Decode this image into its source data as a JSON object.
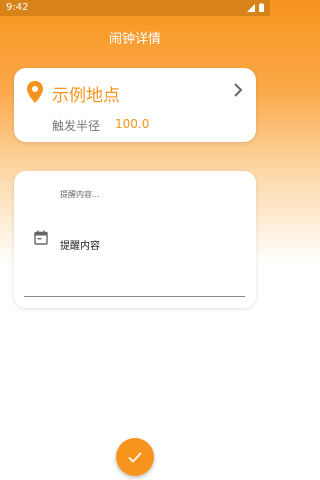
{
  "status_bar": {
    "time": "9:42",
    "icons": [
      "signal-icon",
      "battery-icon"
    ]
  },
  "header": {
    "title": "闹钟详情"
  },
  "location_card": {
    "icon": "location-pin-icon",
    "location_name": "示例地点",
    "radius_label": "触发半径",
    "radius_value": "100.0",
    "nav_icon": "chevron-right-icon"
  },
  "content_card": {
    "hint": "提醒内容...",
    "icon": "calendar-icon",
    "input_value": "提醒内容"
  },
  "fab": {
    "icon": "check-icon"
  },
  "colors": {
    "accent": "#f7941d",
    "status_bar": "#d8821a",
    "text_secondary": "#777777"
  }
}
